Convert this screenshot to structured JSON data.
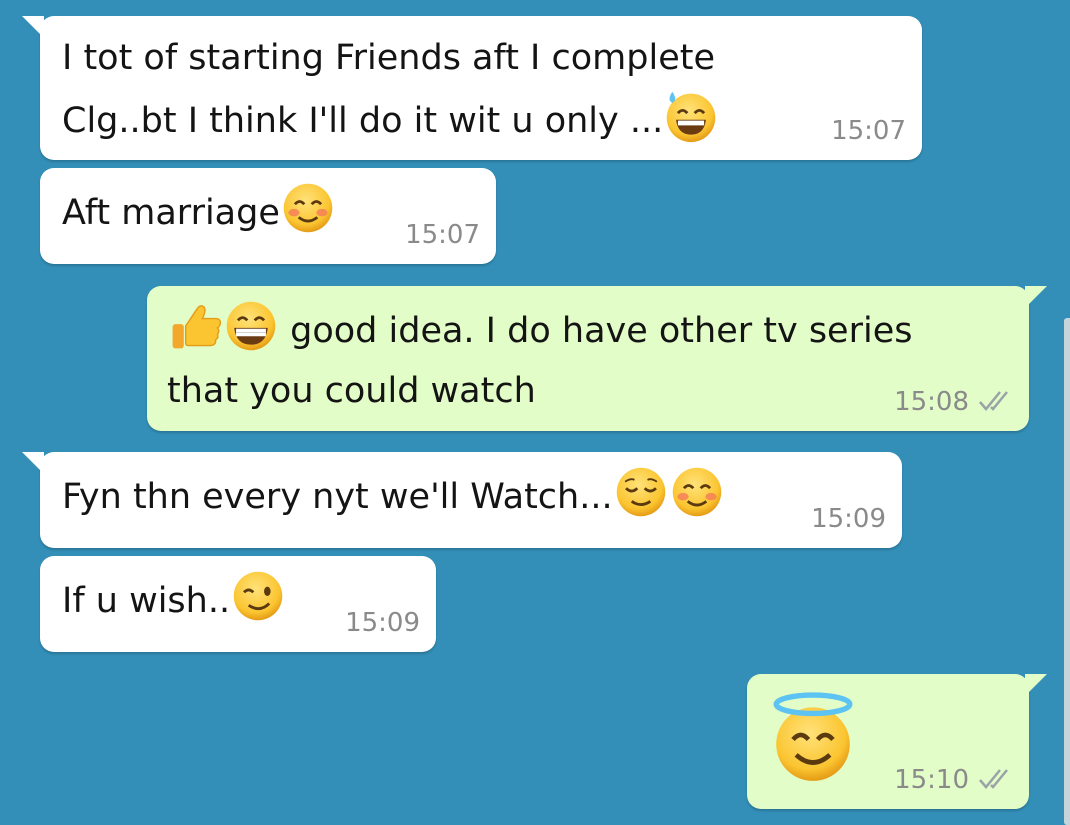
{
  "messages": [
    {
      "direction": "incoming",
      "text_line1": "I tot of starting Friends aft I complete",
      "text_line2": "Clg..bt I think I'll do it wit u only ...",
      "emojis": [
        "grinning-sweat-emoji"
      ],
      "time": "15:07"
    },
    {
      "direction": "incoming",
      "text": "Aft marriage",
      "emojis": [
        "smiling-blush-emoji"
      ],
      "time": "15:07"
    },
    {
      "direction": "outgoing",
      "emojis": [
        "thumbs-up-emoji",
        "grinning-emoji"
      ],
      "text_line1": " good idea. I do have other tv series",
      "text_line2": "that you could watch",
      "time": "15:08",
      "status": "read-ticks"
    },
    {
      "direction": "incoming",
      "text": "Fyn thn every nyt we'll Watch...",
      "emojis": [
        "relieved-emoji",
        "smiling-blush-emoji"
      ],
      "time": "15:09"
    },
    {
      "direction": "incoming",
      "text": "If u wish..",
      "emojis": [
        "winking-emoji"
      ],
      "time": "15:09"
    },
    {
      "direction": "outgoing",
      "emojis": [
        "halo-emoji"
      ],
      "time": "15:10",
      "status": "read-ticks"
    }
  ],
  "colors": {
    "background": "#338fb8",
    "incoming": "#ffffff",
    "outgoing": "#e2fdc8",
    "timestamp": "#8a8a8a"
  }
}
